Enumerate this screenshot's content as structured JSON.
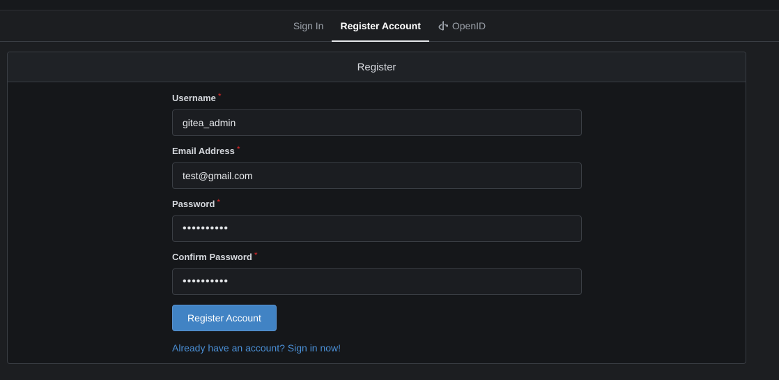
{
  "tabs": [
    {
      "label": "Sign In",
      "active": false
    },
    {
      "label": "Register Account",
      "active": true
    },
    {
      "label": "OpenID",
      "active": false,
      "icon": "openid-icon"
    }
  ],
  "card": {
    "title": "Register"
  },
  "form": {
    "username": {
      "label": "Username",
      "required_mark": "*",
      "value": "gitea_admin"
    },
    "email": {
      "label": "Email Address",
      "required_mark": "*",
      "value": "test@gmail.com"
    },
    "password": {
      "label": "Password",
      "required_mark": "*",
      "value": "••••••••••"
    },
    "confirm_password": {
      "label": "Confirm Password",
      "required_mark": "*",
      "value": "••••••••••"
    },
    "submit_label": "Register Account",
    "signin_link": "Already have an account? Sign in now!"
  },
  "colors": {
    "accent": "#4183c4",
    "link": "#4a8fd6",
    "required": "#db2828",
    "background": "#1c1e21"
  }
}
